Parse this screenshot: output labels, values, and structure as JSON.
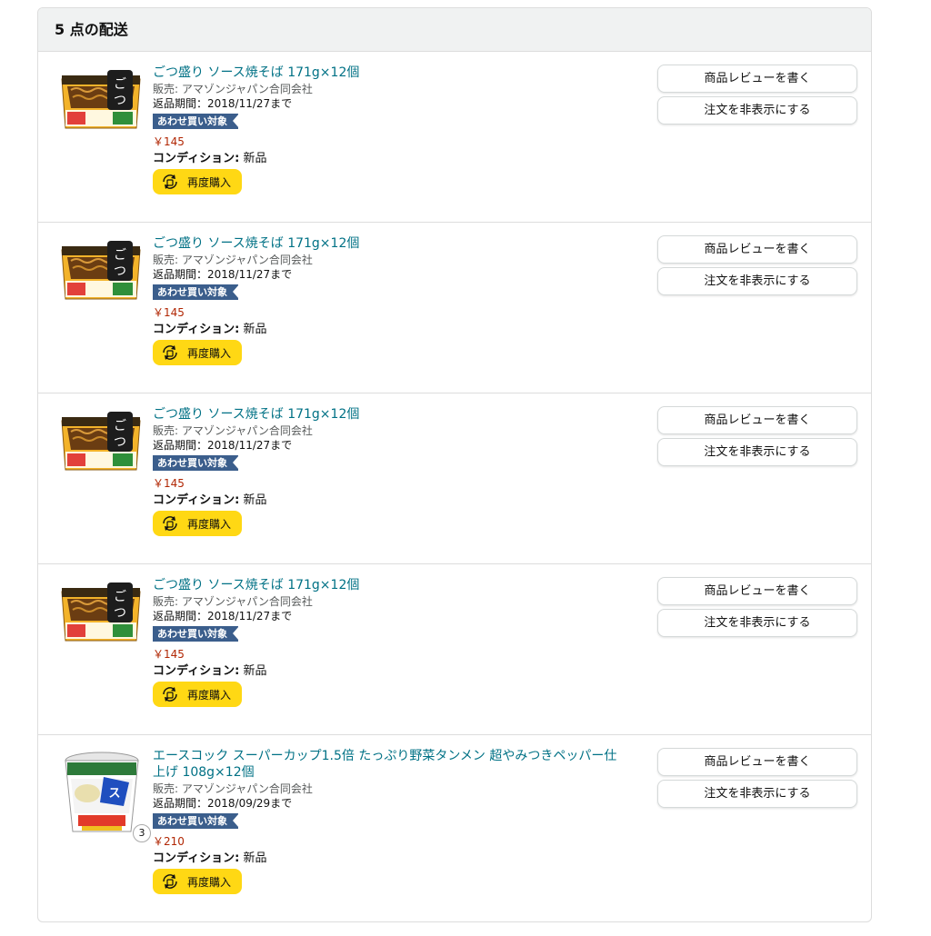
{
  "shipment": {
    "title": "5 点の配送"
  },
  "labels": {
    "review_button": "商品レビューを書く",
    "hide_button": "注文を非表示にする",
    "rebuy_button": "再度購入",
    "addon_badge": "あわせ買い対象",
    "condition_label": "コンディション:",
    "seller_prefix": "販売: ",
    "return_prefix": "返品期間："
  },
  "items": [
    {
      "title": "ごつ盛り ソース焼そば 171g×12個",
      "seller": "アマゾンジャパン合同会社",
      "return_until": "2018/11/27まで",
      "price": "￥145",
      "condition": "新品",
      "image": "yakisoba-cup-image"
    },
    {
      "title": "ごつ盛り ソース焼そば 171g×12個",
      "seller": "アマゾンジャパン合同会社",
      "return_until": "2018/11/27まで",
      "price": "￥145",
      "condition": "新品",
      "image": "yakisoba-cup-image"
    },
    {
      "title": "ごつ盛り ソース焼そば 171g×12個",
      "seller": "アマゾンジャパン合同会社",
      "return_until": "2018/11/27まで",
      "price": "￥145",
      "condition": "新品",
      "image": "yakisoba-cup-image"
    },
    {
      "title": "ごつ盛り ソース焼そば 171g×12個",
      "seller": "アマゾンジャパン合同会社",
      "return_until": "2018/11/27まで",
      "price": "￥145",
      "condition": "新品",
      "image": "yakisoba-cup-image"
    },
    {
      "title": "エースコック スーパーカップ1.5倍 たっぷり野菜タンメン 超やみつきペッパー仕上げ 108g×12個",
      "seller": "アマゾンジャパン合同会社",
      "return_until": "2018/09/29まで",
      "price": "￥210",
      "condition": "新品",
      "image": "tanmen-cup-image",
      "quantity": "3"
    }
  ]
}
